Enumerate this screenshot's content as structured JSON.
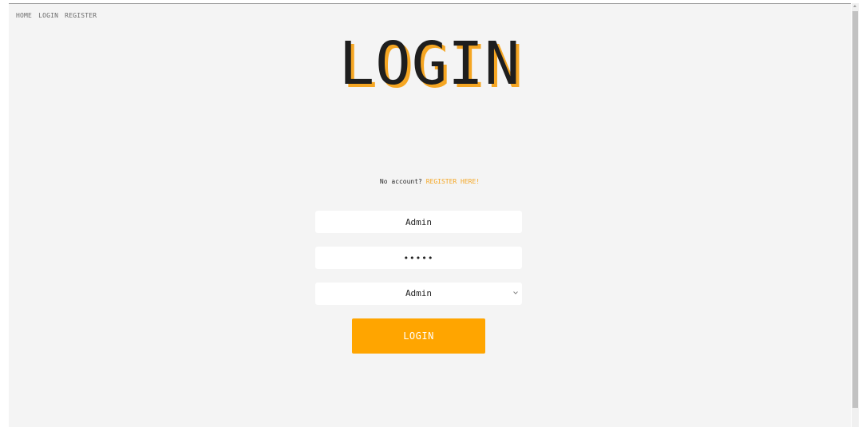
{
  "nav": {
    "items": [
      {
        "label": "HOME"
      },
      {
        "label": "LOGIN"
      },
      {
        "label": "REGISTER"
      }
    ]
  },
  "page": {
    "title": "LOGIN"
  },
  "register_prompt": {
    "text": "No account?",
    "link": "REGISTER HERE!"
  },
  "form": {
    "username_value": "Admin",
    "password_value": "•••••",
    "role_selected": "Admin",
    "submit_label": "LOGIN"
  },
  "colors": {
    "accent": "#ffa500",
    "background": "#f4f4f4",
    "title_text": "#1e1e1e"
  },
  "icons": {
    "select_arrow": "chevron-down-icon"
  }
}
